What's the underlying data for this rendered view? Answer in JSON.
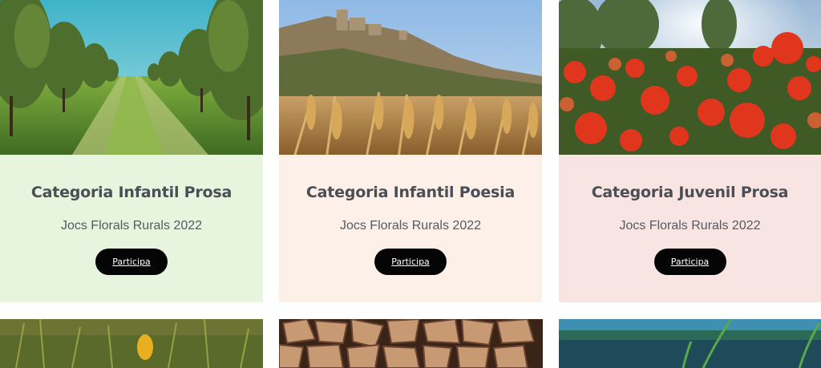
{
  "cards": [
    {
      "title": "Categoria Infantil Prosa",
      "subtitle": "Jocs Florals Rurals 2022",
      "button_label": "Participa",
      "background": "#e7f4de",
      "image": "olive-orchard-image"
    },
    {
      "title": "Categoria Infantil Poesia",
      "subtitle": "Jocs Florals Rurals 2022",
      "button_label": "Participa",
      "background": "#fcf0e9",
      "image": "wheat-field-image"
    },
    {
      "title": "Categoria Juvenil Prosa",
      "subtitle": "Jocs Florals Rurals 2022",
      "button_label": "Participa",
      "background": "#f8e5e3",
      "image": "poppy-field-image"
    }
  ],
  "bottom_row": [
    {
      "image": "meadow-flower-image"
    },
    {
      "image": "firewood-stack-image"
    },
    {
      "image": "grass-lake-image"
    }
  ],
  "colors": {
    "title": "#4a4e55",
    "subtitle": "#555a60",
    "button_bg": "#050505",
    "button_text": "#ffffff"
  }
}
